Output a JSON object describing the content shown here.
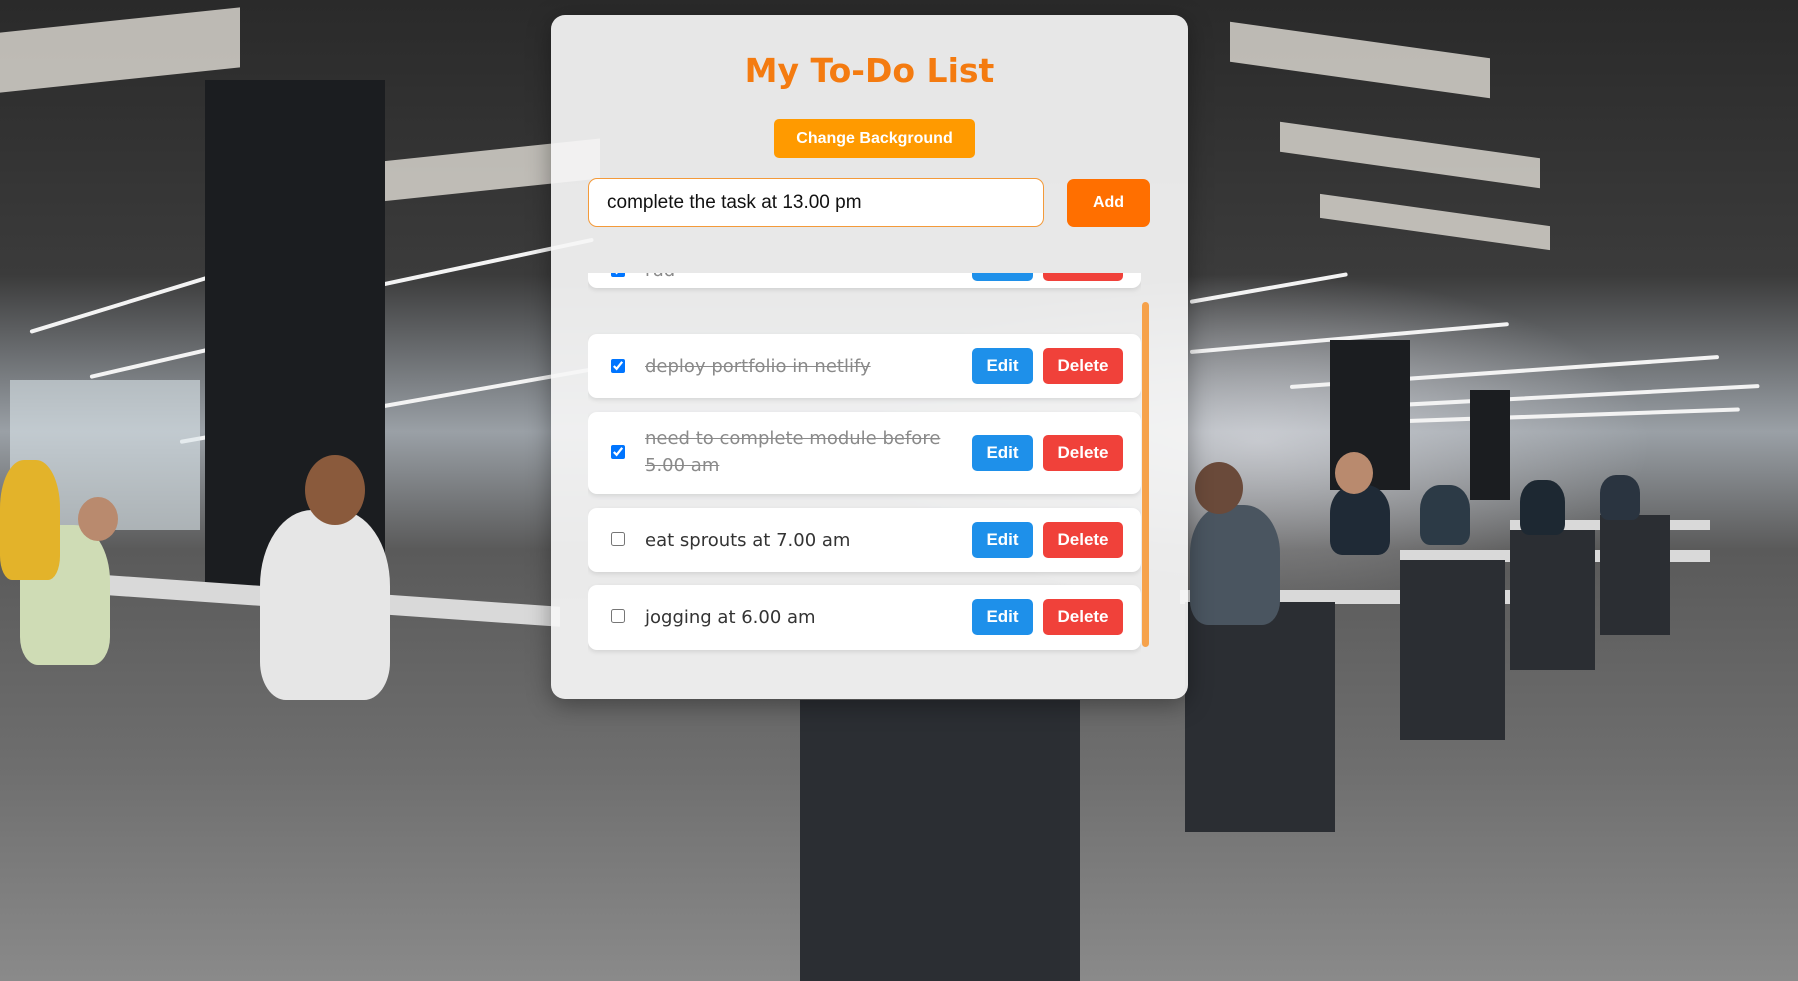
{
  "app": {
    "title": "My To-Do List",
    "change_background_label": "Change Background"
  },
  "input": {
    "value": "complete the task at 13.00 pm",
    "add_label": "Add"
  },
  "tasks": [
    {
      "text": "rud",
      "done": true
    },
    {
      "text": "deploy portfolio in netlify",
      "done": true
    },
    {
      "text": "need to complete module before 5.00 am",
      "done": true
    },
    {
      "text": "eat sprouts at 7.00 am",
      "done": false
    },
    {
      "text": "jogging at 6.00 am",
      "done": false
    }
  ],
  "labels": {
    "edit": "Edit",
    "delete": "Delete"
  },
  "colors": {
    "title": "#f47b10",
    "change_background": "#ff9a00",
    "add": "#ff6f00",
    "edit": "#1e90ea",
    "delete": "#f0413a",
    "scrollbar": "#f6a24b"
  }
}
